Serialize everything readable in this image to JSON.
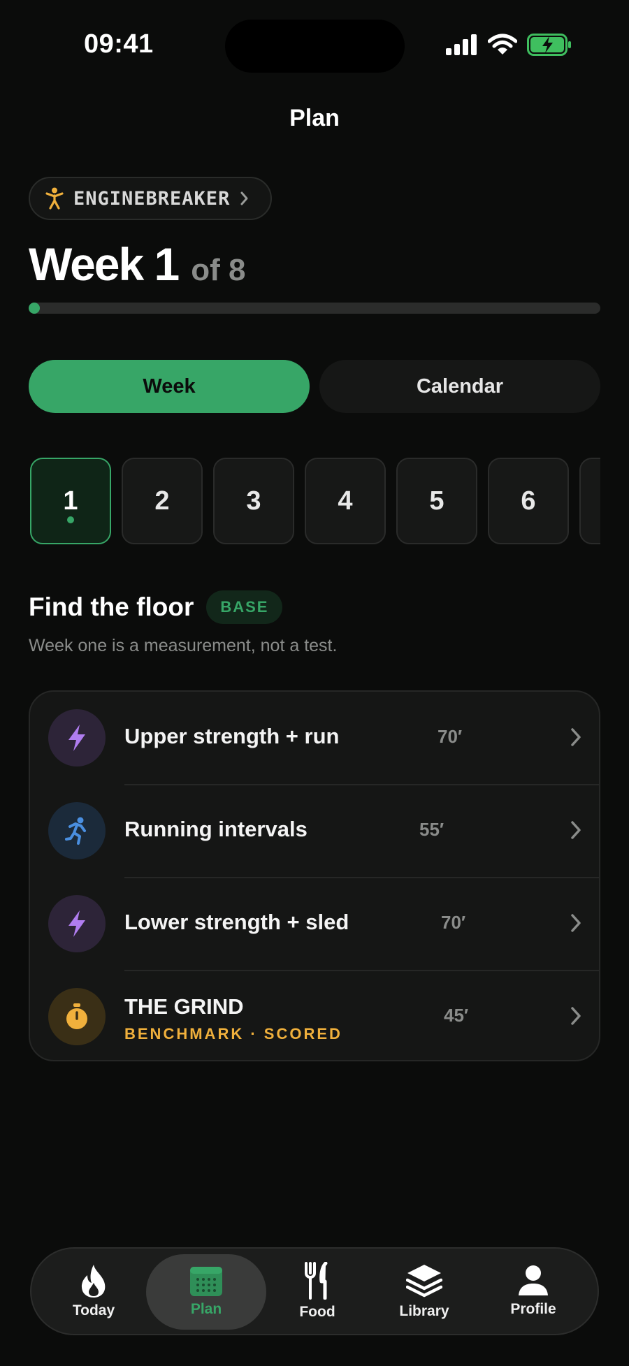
{
  "status": {
    "time": "09:41"
  },
  "nav": {
    "title": "Plan"
  },
  "program": {
    "name": "ENGINEBREAKER"
  },
  "week": {
    "current_label": "Week 1",
    "total_label": "of 8",
    "progress": 0.01
  },
  "segments": {
    "week": "Week",
    "calendar": "Calendar"
  },
  "week_chips": [
    "1",
    "2",
    "3",
    "4",
    "5",
    "6"
  ],
  "section": {
    "title": "Find the floor",
    "badge": "BASE",
    "subtitle": "Week one is a measurement, not a test."
  },
  "workouts": [
    {
      "title": "Upper strength + run",
      "duration": "70′",
      "icon": "bolt-icon"
    },
    {
      "title": "Running intervals",
      "duration": "55′",
      "icon": "runner-icon"
    },
    {
      "title": "Lower strength + sled",
      "duration": "70′",
      "icon": "bolt-icon"
    },
    {
      "title": "THE GRIND",
      "subtitle": "BENCHMARK · SCORED",
      "duration": "45′",
      "icon": "stopwatch-icon"
    }
  ],
  "tabs": [
    {
      "label": "Today",
      "icon": "flame-icon"
    },
    {
      "label": "Plan",
      "icon": "calendar-icon"
    },
    {
      "label": "Food",
      "icon": "fork-knife-icon"
    },
    {
      "label": "Library",
      "icon": "layers-icon"
    },
    {
      "label": "Profile",
      "icon": "person-icon"
    }
  ],
  "colors": {
    "accent": "#37a667",
    "gold": "#f0b03c",
    "purple": "#b07df0",
    "blue": "#4a8fe0",
    "background": "#0b0c0b"
  }
}
